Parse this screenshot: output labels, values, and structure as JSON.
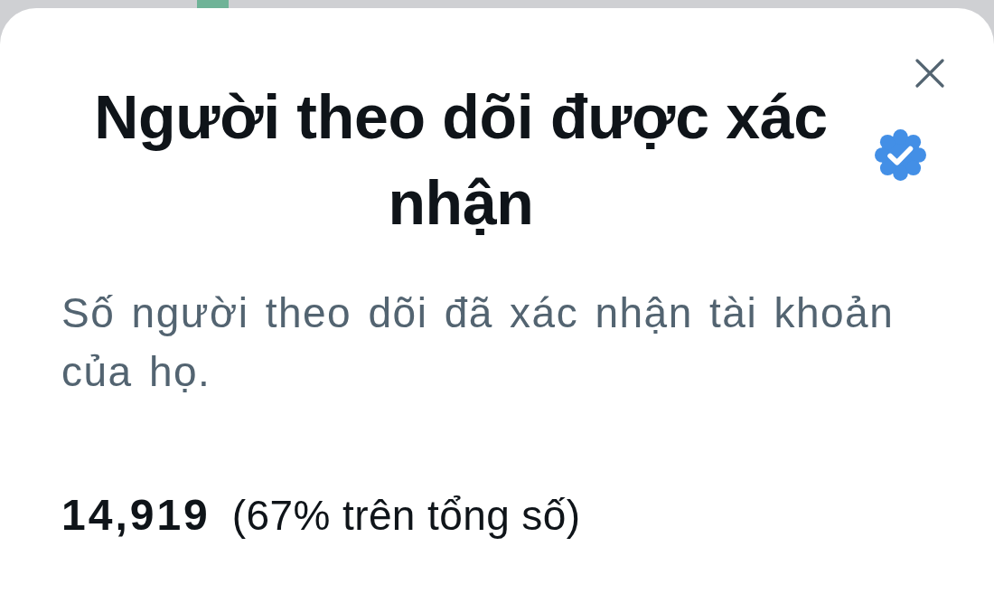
{
  "title": "Người theo dõi được xác nhận",
  "description": "Số người theo dõi đã xác nhận tài khoản của họ.",
  "stats": {
    "count": "14,919",
    "share": "(67% trên tổng số)"
  }
}
